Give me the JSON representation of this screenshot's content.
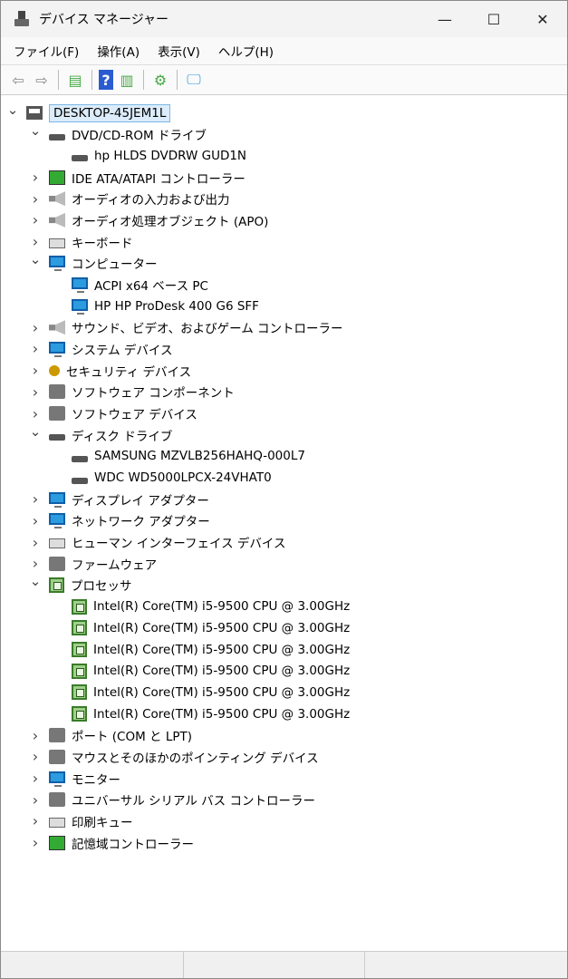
{
  "window": {
    "title": "デバイス マネージャー",
    "minimize": "—",
    "maximize": "☐",
    "close": "✕"
  },
  "menu": [
    "ファイル(F)",
    "操作(A)",
    "表示(V)",
    "ヘルプ(H)"
  ],
  "toolbar": [
    {
      "icon": "back-arrow-icon",
      "glyph": "⇦"
    },
    {
      "icon": "forward-arrow-icon",
      "glyph": "⇨"
    },
    {
      "sep": true
    },
    {
      "icon": "show-hide-console-tree-icon",
      "glyph": "▤"
    },
    {
      "sep": true
    },
    {
      "icon": "help-icon",
      "glyph": "?"
    },
    {
      "icon": "action-pane-icon",
      "glyph": "▥"
    },
    {
      "sep": true
    },
    {
      "icon": "update-driver-icon",
      "glyph": "⚙"
    },
    {
      "sep": true
    },
    {
      "icon": "scan-hardware-icon",
      "glyph": "🖵"
    }
  ],
  "tree": [
    {
      "label": "DESKTOP-45JEM1L",
      "level": 0,
      "exp": "open",
      "icon": "computer",
      "root": true
    },
    {
      "label": "DVD/CD-ROM ドライブ",
      "level": 1,
      "exp": "open",
      "icon": "disk"
    },
    {
      "label": "hp HLDS DVDRW  GUD1N",
      "level": 2,
      "icon": "disk"
    },
    {
      "label": "IDE ATA/ATAPI コントローラー",
      "level": 1,
      "exp": "closed",
      "icon": "green"
    },
    {
      "label": "オーディオの入力および出力",
      "level": 1,
      "exp": "closed",
      "icon": "speaker"
    },
    {
      "label": "オーディオ処理オブジェクト (APO)",
      "level": 1,
      "exp": "closed",
      "icon": "speaker"
    },
    {
      "label": "キーボード",
      "level": 1,
      "exp": "closed",
      "icon": "keyboard"
    },
    {
      "label": "コンピューター",
      "level": 1,
      "exp": "open",
      "icon": "monitor"
    },
    {
      "label": "ACPI x64 ベース PC",
      "level": 2,
      "icon": "monitor"
    },
    {
      "label": "HP HP ProDesk 400 G6 SFF",
      "level": 2,
      "icon": "monitor"
    },
    {
      "label": "サウンド、ビデオ、およびゲーム コントローラー",
      "level": 1,
      "exp": "closed",
      "icon": "speaker"
    },
    {
      "label": "システム デバイス",
      "level": 1,
      "exp": "closed",
      "icon": "monitor"
    },
    {
      "label": "セキュリティ デバイス",
      "level": 1,
      "exp": "closed",
      "icon": "key"
    },
    {
      "label": "ソフトウェア コンポーネント",
      "level": 1,
      "exp": "closed",
      "icon": "generic"
    },
    {
      "label": "ソフトウェア デバイス",
      "level": 1,
      "exp": "closed",
      "icon": "generic"
    },
    {
      "label": "ディスク ドライブ",
      "level": 1,
      "exp": "open",
      "icon": "disk"
    },
    {
      "label": "SAMSUNG MZVLB256HAHQ-000L7",
      "level": 2,
      "icon": "disk"
    },
    {
      "label": "WDC WD5000LPCX-24VHAT0",
      "level": 2,
      "icon": "disk"
    },
    {
      "label": "ディスプレイ アダプター",
      "level": 1,
      "exp": "closed",
      "icon": "monitor"
    },
    {
      "label": "ネットワーク アダプター",
      "level": 1,
      "exp": "closed",
      "icon": "monitor"
    },
    {
      "label": "ヒューマン インターフェイス デバイス",
      "level": 1,
      "exp": "closed",
      "icon": "keyboard"
    },
    {
      "label": "ファームウェア",
      "level": 1,
      "exp": "closed",
      "icon": "generic"
    },
    {
      "label": "プロセッサ",
      "level": 1,
      "exp": "open",
      "icon": "cpu"
    },
    {
      "label": "Intel(R) Core(TM) i5-9500 CPU @ 3.00GHz",
      "level": 2,
      "icon": "cpu"
    },
    {
      "label": "Intel(R) Core(TM) i5-9500 CPU @ 3.00GHz",
      "level": 2,
      "icon": "cpu"
    },
    {
      "label": "Intel(R) Core(TM) i5-9500 CPU @ 3.00GHz",
      "level": 2,
      "icon": "cpu"
    },
    {
      "label": "Intel(R) Core(TM) i5-9500 CPU @ 3.00GHz",
      "level": 2,
      "icon": "cpu"
    },
    {
      "label": "Intel(R) Core(TM) i5-9500 CPU @ 3.00GHz",
      "level": 2,
      "icon": "cpu"
    },
    {
      "label": "Intel(R) Core(TM) i5-9500 CPU @ 3.00GHz",
      "level": 2,
      "icon": "cpu"
    },
    {
      "label": "ポート (COM と LPT)",
      "level": 1,
      "exp": "closed",
      "icon": "generic"
    },
    {
      "label": "マウスとそのほかのポインティング デバイス",
      "level": 1,
      "exp": "closed",
      "icon": "generic"
    },
    {
      "label": "モニター",
      "level": 1,
      "exp": "closed",
      "icon": "monitor"
    },
    {
      "label": "ユニバーサル シリアル バス コントローラー",
      "level": 1,
      "exp": "closed",
      "icon": "generic"
    },
    {
      "label": "印刷キュー",
      "level": 1,
      "exp": "closed",
      "icon": "keyboard"
    },
    {
      "label": "記憶域コントローラー",
      "level": 1,
      "exp": "closed",
      "icon": "green"
    }
  ]
}
